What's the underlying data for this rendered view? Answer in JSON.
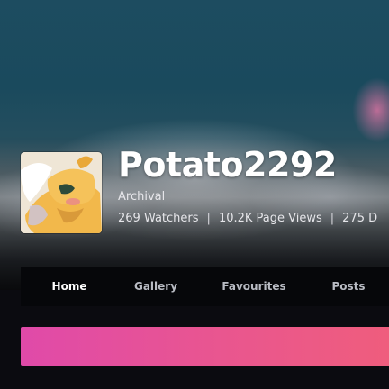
{
  "profile": {
    "username": "Potato2292",
    "role": "Archival",
    "stats": {
      "watchers": "269 Watchers",
      "page_views": "10.2K Page Views",
      "deviations": "275 D"
    }
  },
  "nav": {
    "items": [
      {
        "label": "Home",
        "active": true
      },
      {
        "label": "Gallery",
        "active": false
      },
      {
        "label": "Favourites",
        "active": false
      },
      {
        "label": "Posts",
        "active": false
      }
    ]
  },
  "colors": {
    "banner_start": "#e04aa9",
    "banner_end": "#ef5d7d",
    "nav_background": "#06070a",
    "page_background": "#0b0b10"
  }
}
